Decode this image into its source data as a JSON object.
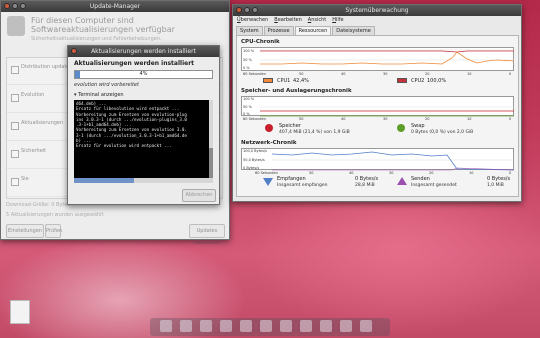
{
  "colors": {
    "cpu1": "#f08a3a",
    "cpu2": "#c8303a",
    "memory": "#c8202a",
    "swap": "#5c9e2a",
    "received": "#4f7fc9",
    "sent": "#9b4fae",
    "progress": "#5a8ccd"
  },
  "update_manager": {
    "title": "Update-Manager",
    "header": "Für diesen Computer sind Softwareaktualisierungen verfügbar",
    "subtitle": "Sicherheitsaktualisierungen und Fehlerbehebungen.",
    "list_items": [
      "Distribution updates",
      "Evolution",
      "Aktualisierungen",
      "Sicherheit",
      "Sie"
    ],
    "status1": "Download-Größe: 0 Bytes",
    "status2": "5 Aktualisierungen wurden ausgewählt",
    "buttons": {
      "settings": "Einstellungen",
      "check": "Prüfen",
      "install": "Updates installieren"
    }
  },
  "progress_dialog": {
    "title": "Aktualisierungen werden installiert",
    "heading": "Aktualisierungen werden installiert",
    "progress_pct": 4,
    "progress_text": "4%",
    "status": "evolution wird vorbereitet",
    "terminal_toggle": "Terminal anzeigen",
    "terminal_lines": [
      "d64.deb) ...",
      "Ersatz für libevolution wird entpackt ...",
      "Vorbereitung zum Ersetzen von evolution-plug",
      "ins 3.0.3-1 (durch .../evolution-plugins_3.0",
      ".3-1+b1_amd64.deb) ...",
      "",
      "Vorbereitung zum Ersetzen von evolution 3.0.",
      "3-1 (durch .../evolution_3.0.3-1+b1_amd64.de",
      "b) ...",
      "Ersatz für evolution wird entpackt ...",
      ""
    ],
    "close_button": "Abbrechen"
  },
  "system_monitor": {
    "title": "Systemüberwachung",
    "menu": [
      "Überwachen",
      "Bearbeiten",
      "Ansicht",
      "Hilfe"
    ],
    "tabs": [
      "System",
      "Prozesse",
      "Ressourcen",
      "Dateisysteme"
    ],
    "active_tab": "Ressourcen",
    "cpu": {
      "title": "CPU-Chronik",
      "y_ticks": [
        "100 %",
        "50 %",
        "0 %"
      ],
      "x_ticks": [
        "60 Sekunden",
        "50",
        "40",
        "30",
        "20",
        "10",
        "0"
      ],
      "cpu1_label": "CPU1",
      "cpu1_value": "42,4%",
      "cpu2_label": "CPU2",
      "cpu2_value": "100,0%"
    },
    "memory": {
      "title": "Speicher- und Auslagerungschronik",
      "y_ticks": [
        "100 %",
        "50 %",
        "0 %"
      ],
      "x_ticks": [
        "60 Sekunden",
        "50",
        "40",
        "30",
        "20",
        "10",
        "0"
      ],
      "mem_label": "Speicher",
      "mem_value": "407,4 MiB (21,4 %) von 1,9 GiB",
      "swap_label": "Swap",
      "swap_value": "0 Bytes (0,0 %) von 2,0 GiB"
    },
    "network": {
      "title": "Netzwerk-Chronik",
      "y_ticks": [
        "100,0 Bytes/s",
        "50,0 Bytes/s",
        "0 Bytes/s"
      ],
      "x_ticks": [
        "60 Sekunden",
        "50",
        "40",
        "30",
        "20",
        "10",
        "0"
      ],
      "recv_label": "Empfangen",
      "recv_rate": "0 Bytes/s",
      "recv_total_label": "Insgesamt empfangen",
      "recv_total": "28,8 MiB",
      "sent_label": "Senden",
      "sent_rate": "0 Bytes/s",
      "sent_total_label": "Insgesamt gesendet",
      "sent_total": "1,0 MiB"
    }
  }
}
